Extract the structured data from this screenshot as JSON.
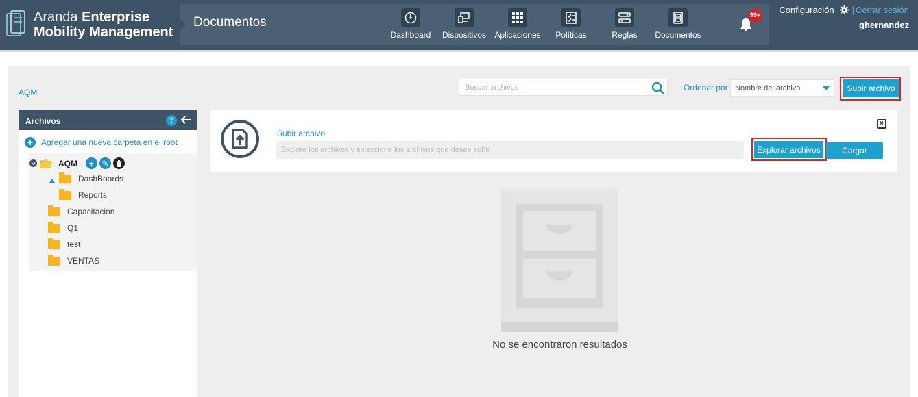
{
  "brand": {
    "light": "Aranda",
    "bold1": "Enterprise",
    "bold2": "Mobility Management"
  },
  "section_title": "Documentos",
  "nav": [
    {
      "label": "Dashboard",
      "icon": "dashboard-icon"
    },
    {
      "label": "Dispositivos",
      "icon": "devices-icon"
    },
    {
      "label": "Aplicaciones",
      "icon": "apps-grid-icon"
    },
    {
      "label": "Políticas",
      "icon": "policies-icon"
    },
    {
      "label": "Reglas",
      "icon": "rules-icon"
    },
    {
      "label": "Documentos",
      "icon": "documents-icon"
    }
  ],
  "notifications": {
    "badge": "99+"
  },
  "user": {
    "config": "Configuración",
    "sep": "|",
    "logout": "Cerrar sesión",
    "name": "ghernandez"
  },
  "breadcrumb": "AQM",
  "search": {
    "placeholder": "Buscar archivos"
  },
  "sort": {
    "label": "Ordenar por:",
    "value": "Nombre del archivo"
  },
  "upload_button": "Subir archivo",
  "sidebar": {
    "title": "Archivos",
    "help": "?",
    "add_root": "Agregar una nueva carpeta en el root",
    "root": "AQM",
    "children": [
      "DashBoards",
      "Reports"
    ],
    "folders": [
      "Capacitacion",
      "Q1",
      "test",
      "VENTAS"
    ]
  },
  "upload_panel": {
    "label": "Subir archivo",
    "placeholder": "Explore los archivos y seleccione los archivos que desee subir",
    "explore": "Explorar archivos",
    "load": "Cargar"
  },
  "empty_message": "No se encontraron resultados",
  "colors": {
    "header": "#3e5466",
    "accent": "#1da1cf",
    "highlight": "#e1242a",
    "folder": "#f8b520"
  }
}
